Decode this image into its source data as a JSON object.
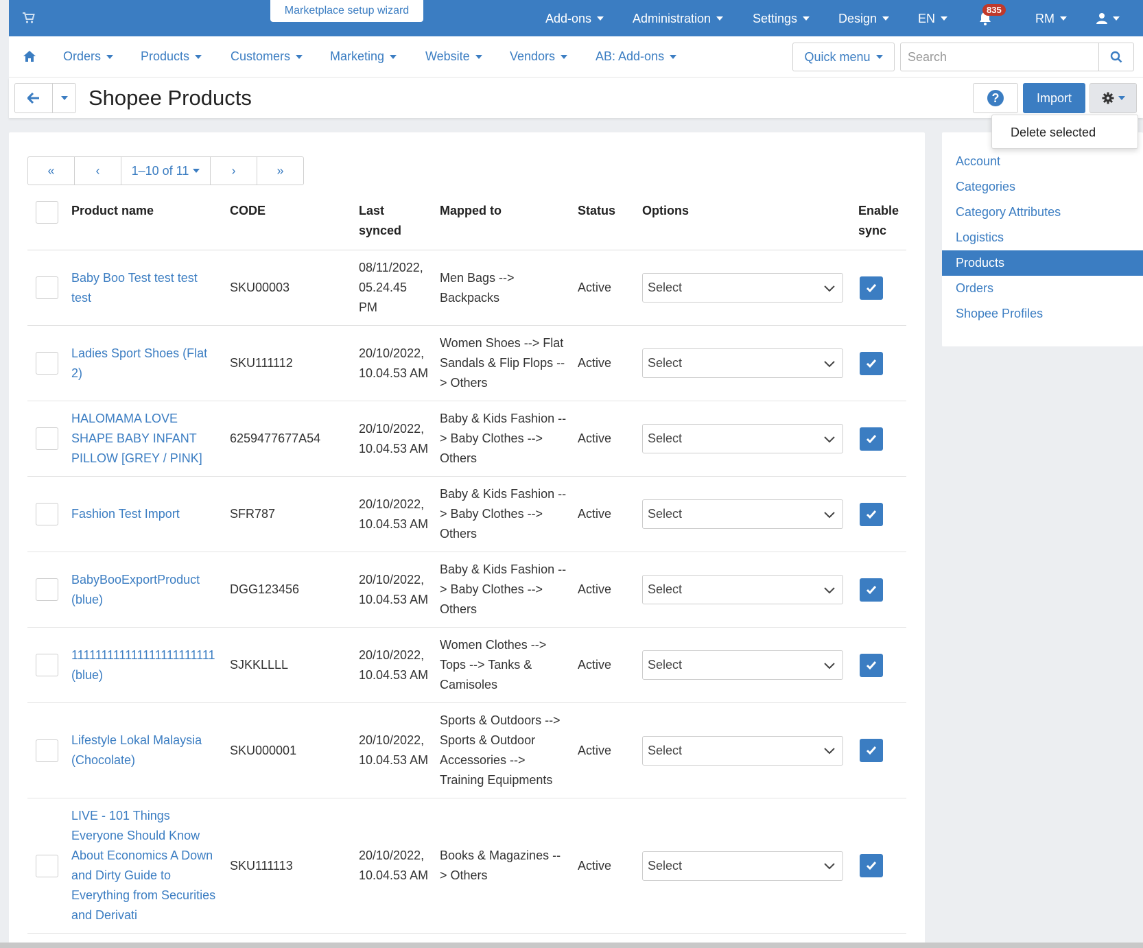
{
  "topbar": {
    "wizard_label": "Marketplace setup wizard",
    "menu": [
      {
        "label": "Add-ons"
      },
      {
        "label": "Administration"
      },
      {
        "label": "Settings"
      },
      {
        "label": "Design"
      },
      {
        "label": "EN"
      },
      {
        "label": "RM"
      }
    ],
    "notifications_count": "835",
    "icons": [
      "cart-icon",
      "bell-icon",
      "user-icon"
    ]
  },
  "nav": {
    "items": [
      {
        "label": "Orders"
      },
      {
        "label": "Products"
      },
      {
        "label": "Customers"
      },
      {
        "label": "Marketing"
      },
      {
        "label": "Website"
      },
      {
        "label": "Vendors"
      },
      {
        "label": "AB: Add-ons"
      }
    ],
    "quick_menu_label": "Quick menu",
    "search_placeholder": "Search"
  },
  "titlebar": {
    "title": "Shopee Products",
    "help_label": "?",
    "import_label": "Import",
    "dropdown_item": "Delete selected"
  },
  "pager": {
    "first": "«",
    "prev": "‹",
    "range": "1–10 of 11",
    "next": "›",
    "last": "»"
  },
  "table": {
    "headers": {
      "name": "Product name",
      "code": "CODE",
      "synced": "Last synced",
      "mapped": "Mapped to",
      "status": "Status",
      "options": "Options",
      "sync": "Enable sync"
    },
    "rows": [
      {
        "name": "Baby Boo Test test test test",
        "code": "SKU00003",
        "synced": "08/11/2022, 05.24.45 PM",
        "mapped": "Men Bags --> Backpacks",
        "status": "Active",
        "option": "Select"
      },
      {
        "name": "Ladies Sport Shoes (Flat 2)",
        "code": "SKU111112",
        "synced": "20/10/2022, 10.04.53 AM",
        "mapped": "Women Shoes --> Flat Sandals & Flip Flops --> Others",
        "status": "Active",
        "option": "Select"
      },
      {
        "name": "HALOMAMA LOVE SHAPE BABY INFANT PILLOW [GREY / PINK]",
        "code": "6259477677A54",
        "synced": "20/10/2022, 10.04.53 AM",
        "mapped": "Baby & Kids Fashion --> Baby Clothes --> Others",
        "status": "Active",
        "option": "Select"
      },
      {
        "name": "Fashion Test Import",
        "code": "SFR787",
        "synced": "20/10/2022, 10.04.53 AM",
        "mapped": "Baby & Kids Fashion --> Baby Clothes --> Others",
        "status": "Active",
        "option": "Select"
      },
      {
        "name": "BabyBooExportProduct (blue)",
        "code": "DGG123456",
        "synced": "20/10/2022, 10.04.53 AM",
        "mapped": "Baby & Kids Fashion --> Baby Clothes --> Others",
        "status": "Active",
        "option": "Select"
      },
      {
        "name": "111111111111111111111111 (blue)",
        "code": "SJKKLLLL",
        "synced": "20/10/2022, 10.04.53 AM",
        "mapped": "Women Clothes --> Tops --> Tanks & Camisoles",
        "status": "Active",
        "option": "Select"
      },
      {
        "name": "Lifestyle Lokal Malaysia (Chocolate)",
        "code": "SKU000001",
        "synced": "20/10/2022, 10.04.53 AM",
        "mapped": "Sports & Outdoors --> Sports & Outdoor Accessories --> Training Equipments",
        "status": "Active",
        "option": "Select"
      },
      {
        "name": "LIVE - 101 Things Everyone Should Know About Economics A Down and Dirty Guide to Everything from Securities and Derivati",
        "code": "SKU111113",
        "synced": "20/10/2022, 10.04.53 AM",
        "mapped": "Books & Magazines --> Others",
        "status": "Active",
        "option": "Select"
      }
    ]
  },
  "sidebar": {
    "items": [
      {
        "label": "Account"
      },
      {
        "label": "Categories"
      },
      {
        "label": "Category Attributes"
      },
      {
        "label": "Logistics"
      },
      {
        "label": "Products",
        "active": true
      },
      {
        "label": "Orders"
      },
      {
        "label": "Shopee Profiles"
      }
    ]
  },
  "colors": {
    "accent": "#3b7dc2",
    "badge": "#c0392b"
  }
}
